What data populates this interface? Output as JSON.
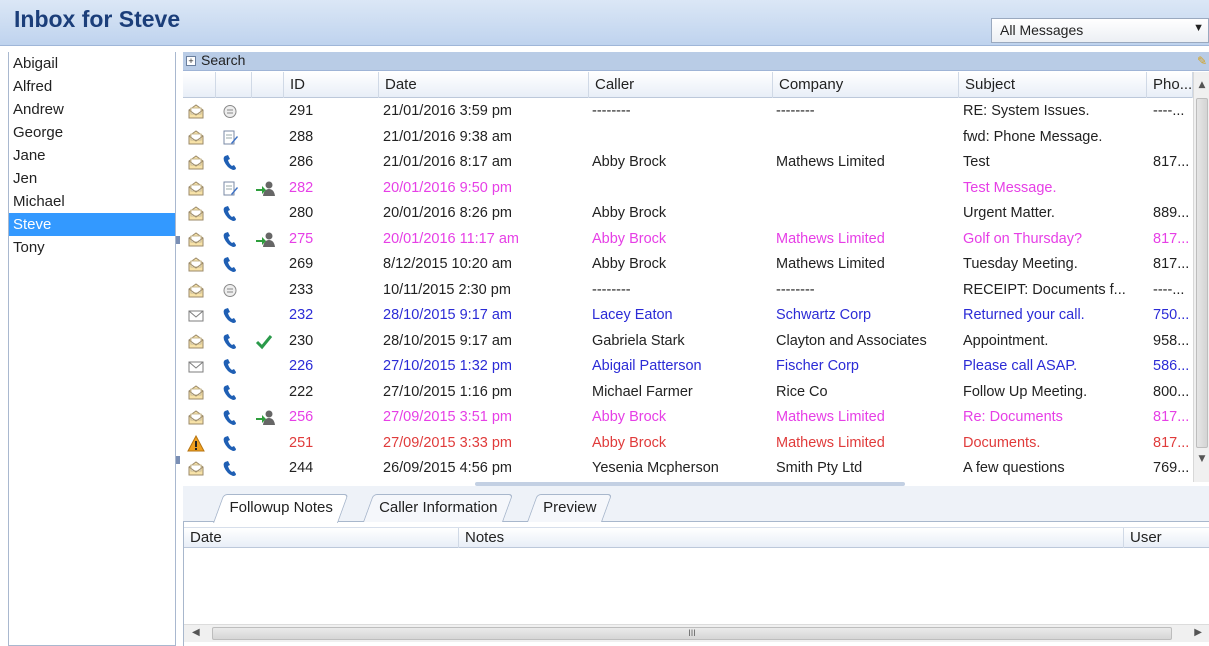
{
  "window": {
    "title": "Inbox for Steve"
  },
  "filter": {
    "selected": "All Messages"
  },
  "sidebar": {
    "users": [
      "Abigail",
      "Alfred",
      "Andrew",
      "George",
      "Jane",
      "Jen",
      "Michael",
      "Steve",
      "Tony"
    ],
    "selected": "Steve"
  },
  "search": {
    "label": "Search"
  },
  "grid": {
    "columns": [
      "ID",
      "Date",
      "Caller",
      "Company",
      "Subject",
      "Pho..."
    ],
    "rows": [
      {
        "icons": [
          "envelope-open-icon",
          "message-icon",
          ""
        ],
        "id": "291",
        "date": "21/01/2016 3:59 pm",
        "caller": "--------",
        "company": "--------",
        "subject": "RE: System Issues.",
        "phone": "----...",
        "style": "normal"
      },
      {
        "icons": [
          "envelope-open-icon",
          "note-edit-icon",
          ""
        ],
        "id": "288",
        "date": "21/01/2016 9:38 am",
        "caller": "",
        "company": "",
        "subject": "fwd: Phone Message.",
        "phone": "",
        "style": "normal"
      },
      {
        "icons": [
          "envelope-open-icon",
          "phone-icon",
          ""
        ],
        "id": "286",
        "date": "21/01/2016 8:17 am",
        "caller": "Abby Brock",
        "company": "Mathews Limited",
        "subject": "Test",
        "phone": "817...",
        "style": "normal"
      },
      {
        "icons": [
          "envelope-open-icon",
          "note-edit-icon",
          "transfer-user-icon"
        ],
        "id": "282",
        "date": "20/01/2016 9:50 pm",
        "caller": "",
        "company": "",
        "subject": "Test Message.",
        "phone": "",
        "style": "pink"
      },
      {
        "icons": [
          "envelope-open-icon",
          "phone-icon",
          ""
        ],
        "id": "280",
        "date": "20/01/2016 8:26 pm",
        "caller": "Abby Brock",
        "company": "",
        "subject": "Urgent Matter.",
        "phone": "889...",
        "style": "normal"
      },
      {
        "icons": [
          "envelope-open-icon",
          "phone-icon",
          "transfer-user-icon"
        ],
        "id": "275",
        "date": "20/01/2016 11:17 am",
        "caller": "Abby Brock",
        "company": "Mathews Limited",
        "subject": "Golf on Thursday?",
        "phone": "817...",
        "style": "pink"
      },
      {
        "icons": [
          "envelope-open-icon",
          "phone-icon",
          ""
        ],
        "id": "269",
        "date": "8/12/2015 10:20 am",
        "caller": "Abby Brock",
        "company": "Mathews Limited",
        "subject": "Tuesday Meeting.",
        "phone": "817...",
        "style": "normal"
      },
      {
        "icons": [
          "envelope-open-icon",
          "message-icon",
          ""
        ],
        "id": "233",
        "date": "10/11/2015 2:30 pm",
        "caller": "--------",
        "company": "--------",
        "subject": "RECEIPT: Documents f...",
        "phone": "----...",
        "style": "normal"
      },
      {
        "icons": [
          "envelope-closed-icon",
          "phone-icon",
          ""
        ],
        "id": "232",
        "date": "28/10/2015 9:17 am",
        "caller": "Lacey Eaton",
        "company": "Schwartz Corp",
        "subject": "Returned your call.",
        "phone": "750...",
        "style": "blue"
      },
      {
        "icons": [
          "envelope-open-icon",
          "phone-icon",
          "check-icon"
        ],
        "id": "230",
        "date": "28/10/2015 9:17 am",
        "caller": "Gabriela Stark",
        "company": "Clayton and Associates",
        "subject": "Appointment.",
        "phone": "958...",
        "style": "normal"
      },
      {
        "icons": [
          "envelope-closed-icon",
          "phone-icon",
          ""
        ],
        "id": "226",
        "date": "27/10/2015 1:32 pm",
        "caller": "Abigail Patterson",
        "company": "Fischer Corp",
        "subject": "Please call ASAP.",
        "phone": "586...",
        "style": "blue"
      },
      {
        "icons": [
          "envelope-open-icon",
          "phone-icon",
          ""
        ],
        "id": "222",
        "date": "27/10/2015 1:16 pm",
        "caller": "Michael Farmer",
        "company": "Rice Co",
        "subject": "Follow Up Meeting.",
        "phone": "800...",
        "style": "normal"
      },
      {
        "icons": [
          "envelope-open-icon",
          "phone-icon",
          "transfer-user-icon"
        ],
        "id": "256",
        "date": "27/09/2015 3:51 pm",
        "caller": "Abby Brock",
        "company": "Mathews Limited",
        "subject": "Re: Documents",
        "phone": "817...",
        "style": "pink"
      },
      {
        "icons": [
          "warning-icon",
          "phone-icon",
          ""
        ],
        "id": "251",
        "date": "27/09/2015 3:33 pm",
        "caller": "Abby Brock",
        "company": "Mathews Limited",
        "subject": "Documents.",
        "phone": "817...",
        "style": "red"
      },
      {
        "icons": [
          "envelope-open-icon",
          "phone-icon",
          ""
        ],
        "id": "244",
        "date": "26/09/2015 4:56 pm",
        "caller": "Yesenia Mcpherson",
        "company": "Smith Pty Ltd",
        "subject": "A few questions",
        "phone": "769...",
        "style": "normal"
      }
    ]
  },
  "tabs": [
    {
      "label": "Followup Notes",
      "active": true
    },
    {
      "label": "Caller Information",
      "active": false
    },
    {
      "label": "Preview",
      "active": false
    }
  ],
  "notes": {
    "columns": [
      "Date",
      "Notes",
      "User"
    ]
  },
  "colors": {
    "selection": "#3399ff",
    "pink": "#e63fe6",
    "blue": "#2b2bd6",
    "red": "#e03b3b",
    "header": "#1b3e7a"
  }
}
